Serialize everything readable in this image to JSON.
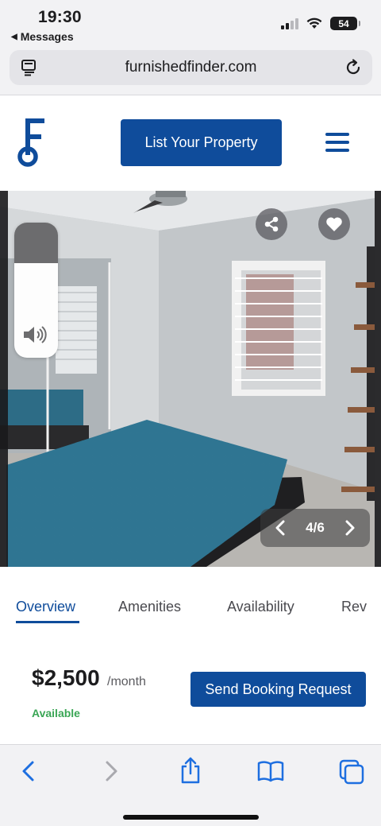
{
  "status_bar": {
    "time": "19:30",
    "back_app": "Messages",
    "battery": "54"
  },
  "browser": {
    "url": "furnishedfinder.com"
  },
  "site_header": {
    "logo_icon": "furnished-finder-key-logo",
    "cta_label": "List Your Property"
  },
  "gallery": {
    "page_indicator": "4/6",
    "volume_level": 0.3
  },
  "tabs": [
    {
      "label": "Overview",
      "active": true
    },
    {
      "label": "Amenities",
      "active": false
    },
    {
      "label": "Availability",
      "active": false
    },
    {
      "label": "Rev",
      "active": false
    }
  ],
  "listing": {
    "price": "$2,500",
    "period": "/month",
    "status": "Available",
    "booking_label": "Send Booking Request"
  },
  "colors": {
    "brand_blue": "#0f4c9b",
    "available_green": "#3aa655",
    "ios_blue": "#1e6fe0"
  }
}
